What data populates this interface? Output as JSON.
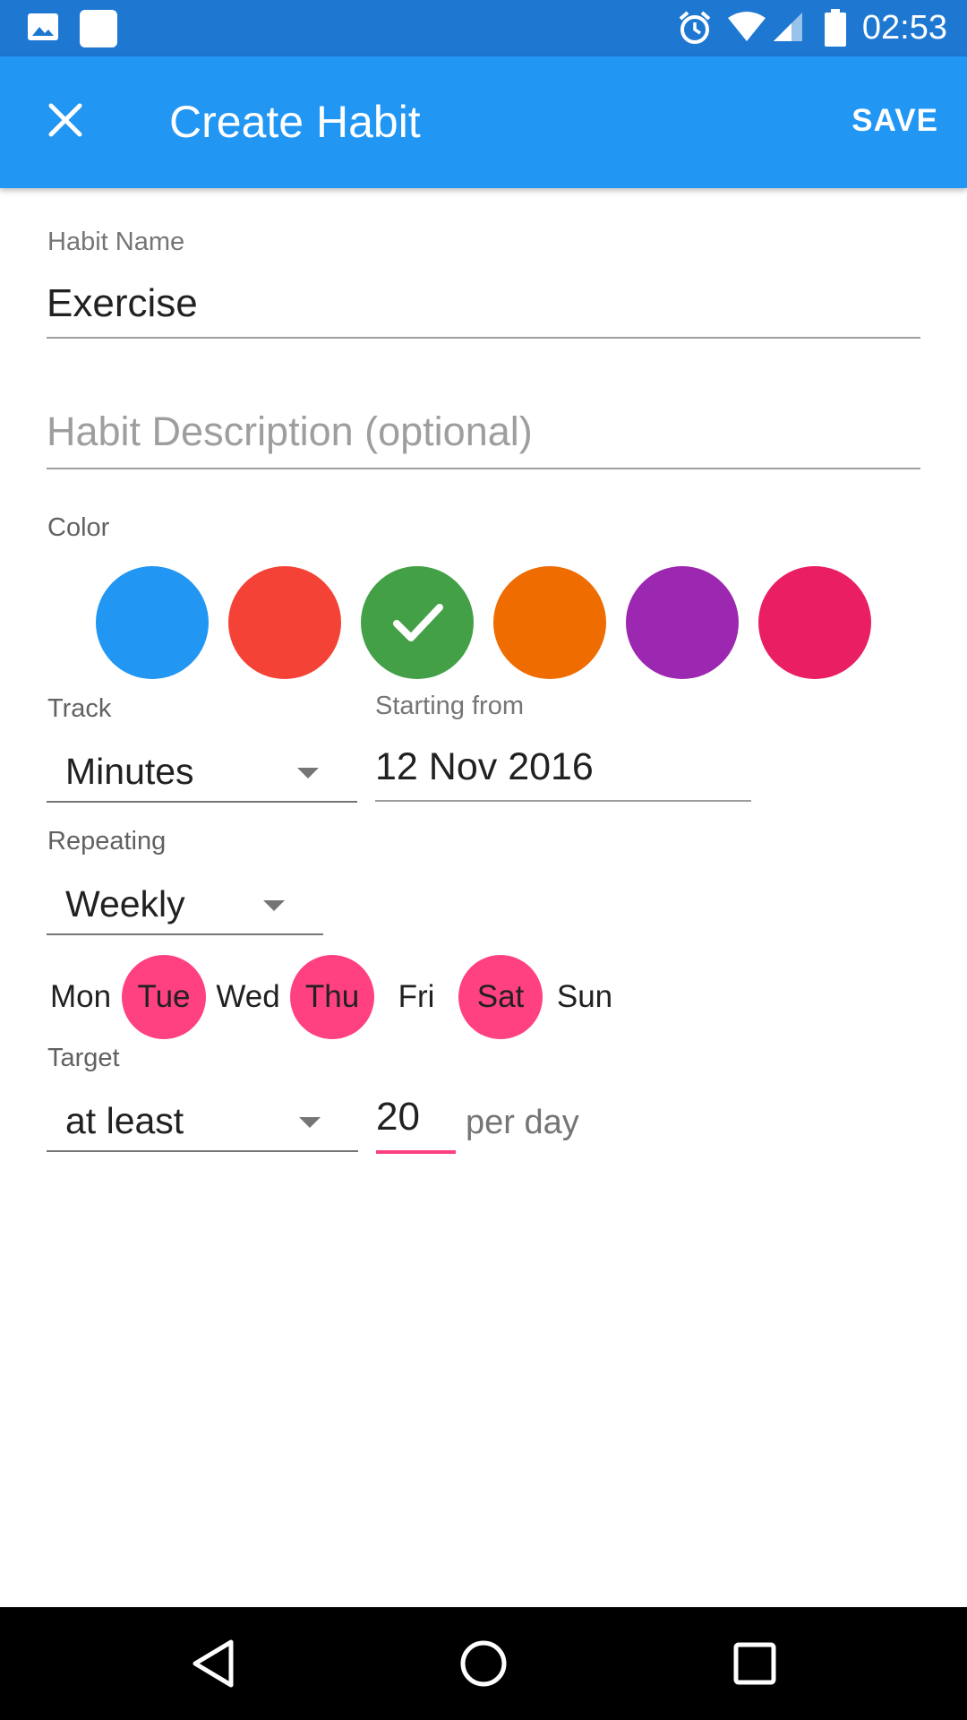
{
  "status_bar": {
    "time": "02:53",
    "icons": [
      "image-icon",
      "notification-square-icon",
      "alarm-icon",
      "wifi-icon",
      "signal-icon",
      "battery-icon"
    ]
  },
  "app_bar": {
    "title": "Create Habit",
    "save_label": "SAVE",
    "close_icon": "close-icon",
    "background": "#2196F3"
  },
  "form": {
    "habit_name": {
      "label": "Habit Name",
      "value": "Exercise"
    },
    "habit_description": {
      "placeholder": "Habit Description (optional)",
      "value": ""
    },
    "color": {
      "label": "Color",
      "options": [
        "#2196F3",
        "#F44336",
        "#43A047",
        "#EF6C00",
        "#9C27B0",
        "#E91E63"
      ],
      "selected_index": 2
    },
    "track": {
      "label": "Track",
      "value": "Minutes"
    },
    "starting_from": {
      "label": "Starting from",
      "value": "12 Nov 2016"
    },
    "repeating": {
      "label": "Repeating",
      "value": "Weekly"
    },
    "days": [
      {
        "label": "Mon",
        "selected": false
      },
      {
        "label": "Tue",
        "selected": true
      },
      {
        "label": "Wed",
        "selected": false
      },
      {
        "label": "Thu",
        "selected": true
      },
      {
        "label": "Fri",
        "selected": false
      },
      {
        "label": "Sat",
        "selected": true
      },
      {
        "label": "Sun",
        "selected": false
      }
    ],
    "target": {
      "label": "Target",
      "comparator": "at least",
      "amount": "20",
      "unit": "per day"
    }
  },
  "accent_color": "#FF4081",
  "nav_bar": {
    "icons": [
      "back-icon",
      "home-icon",
      "recents-icon"
    ]
  }
}
